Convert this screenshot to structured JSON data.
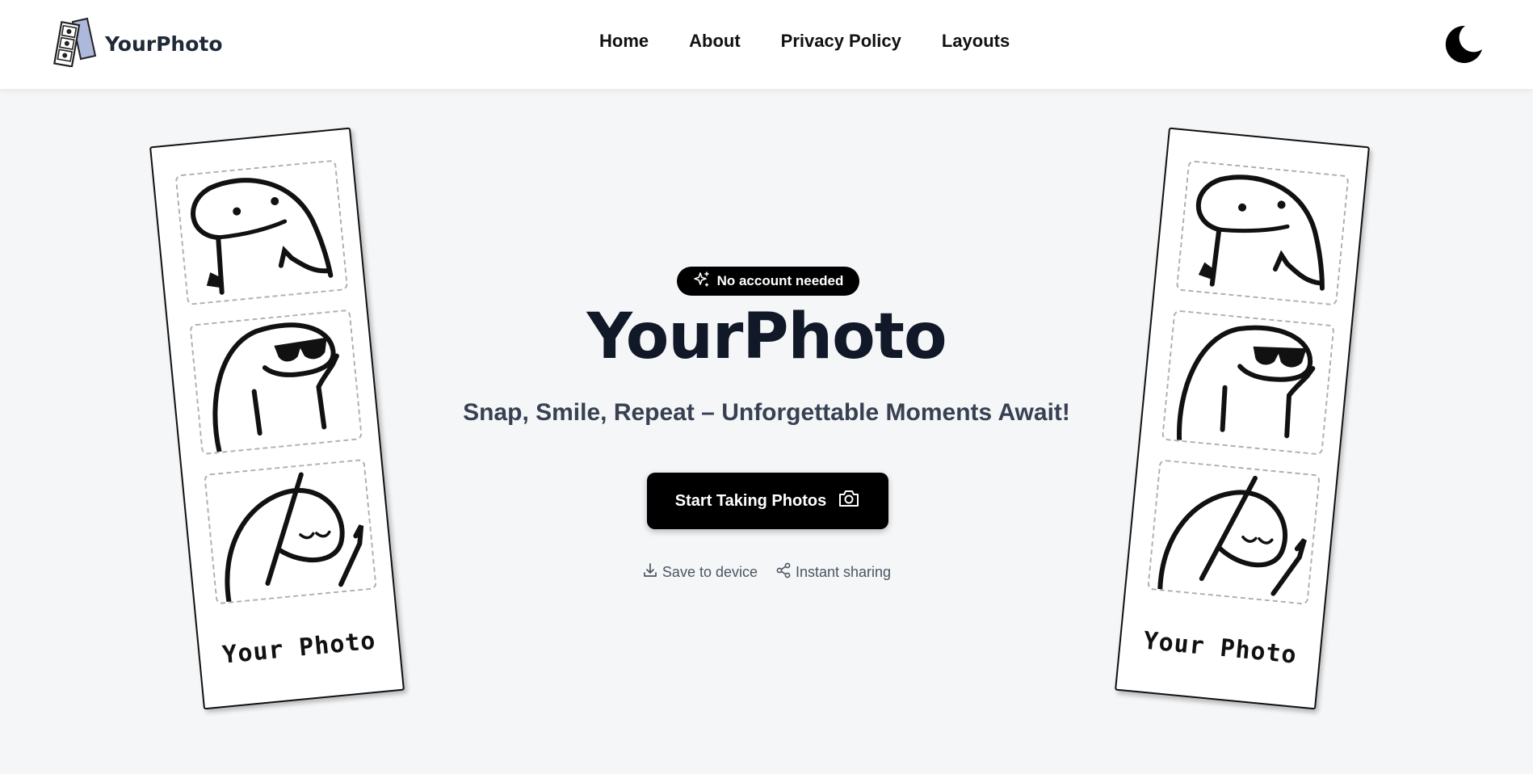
{
  "nav": {
    "brand": "YourPhoto",
    "brand_logo_icon": "photo-strip-logo-icon",
    "links": [
      {
        "label": "Home"
      },
      {
        "label": "About"
      },
      {
        "label": "Privacy Policy"
      },
      {
        "label": "Layouts"
      }
    ],
    "theme_toggle_icon": "moon-icon"
  },
  "hero": {
    "badge": {
      "label": "No account needed",
      "icon": "sparkles-icon"
    },
    "title": "YourPhoto",
    "subtitle": "Snap, Smile, Repeat – Unforgettable Moments Await!",
    "cta": {
      "label": "Start Taking Photos",
      "icon": "camera-icon"
    },
    "features": [
      {
        "label": "Save to device",
        "icon": "download-icon"
      },
      {
        "label": "Instant sharing",
        "icon": "share-icon"
      }
    ]
  },
  "strips": {
    "left": {
      "label": "Your Photo",
      "frames": [
        "thumbs-up-character",
        "sunglasses-character",
        "waving-character"
      ]
    },
    "right": {
      "label": "Your Photo",
      "frames": [
        "thumbs-up-character",
        "sunglasses-character",
        "waving-character"
      ]
    }
  },
  "colors": {
    "background": "#f5f6f8",
    "primary": "#000000",
    "title": "#111827",
    "subtitle": "#374151",
    "muted": "#4b5563"
  }
}
